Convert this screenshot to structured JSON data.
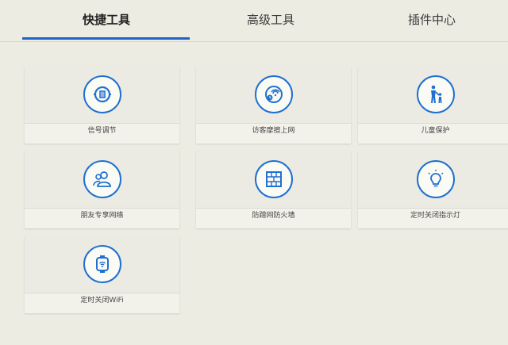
{
  "tabs": [
    {
      "label": "快捷工具",
      "active": true
    },
    {
      "label": "高级工具",
      "active": false
    },
    {
      "label": "插件中心",
      "active": false
    }
  ],
  "cards": [
    {
      "label": "信号调节",
      "icon": "signal-adjust-icon"
    },
    {
      "label": "访客摩擦上网",
      "icon": "guest-network-icon"
    },
    {
      "label": "儿童保护",
      "icon": "child-protection-icon"
    },
    {
      "label": "朋友专享网络",
      "icon": "friends-network-icon"
    },
    {
      "label": "防蹭网防火墙",
      "icon": "firewall-icon"
    },
    {
      "label": "定时关闭指示灯",
      "icon": "lightbulb-icon"
    },
    {
      "label": "定时关闭WiFi",
      "icon": "watch-wifi-icon"
    }
  ],
  "colors": {
    "accent": "#1f70d1",
    "background": "#ecece3"
  }
}
